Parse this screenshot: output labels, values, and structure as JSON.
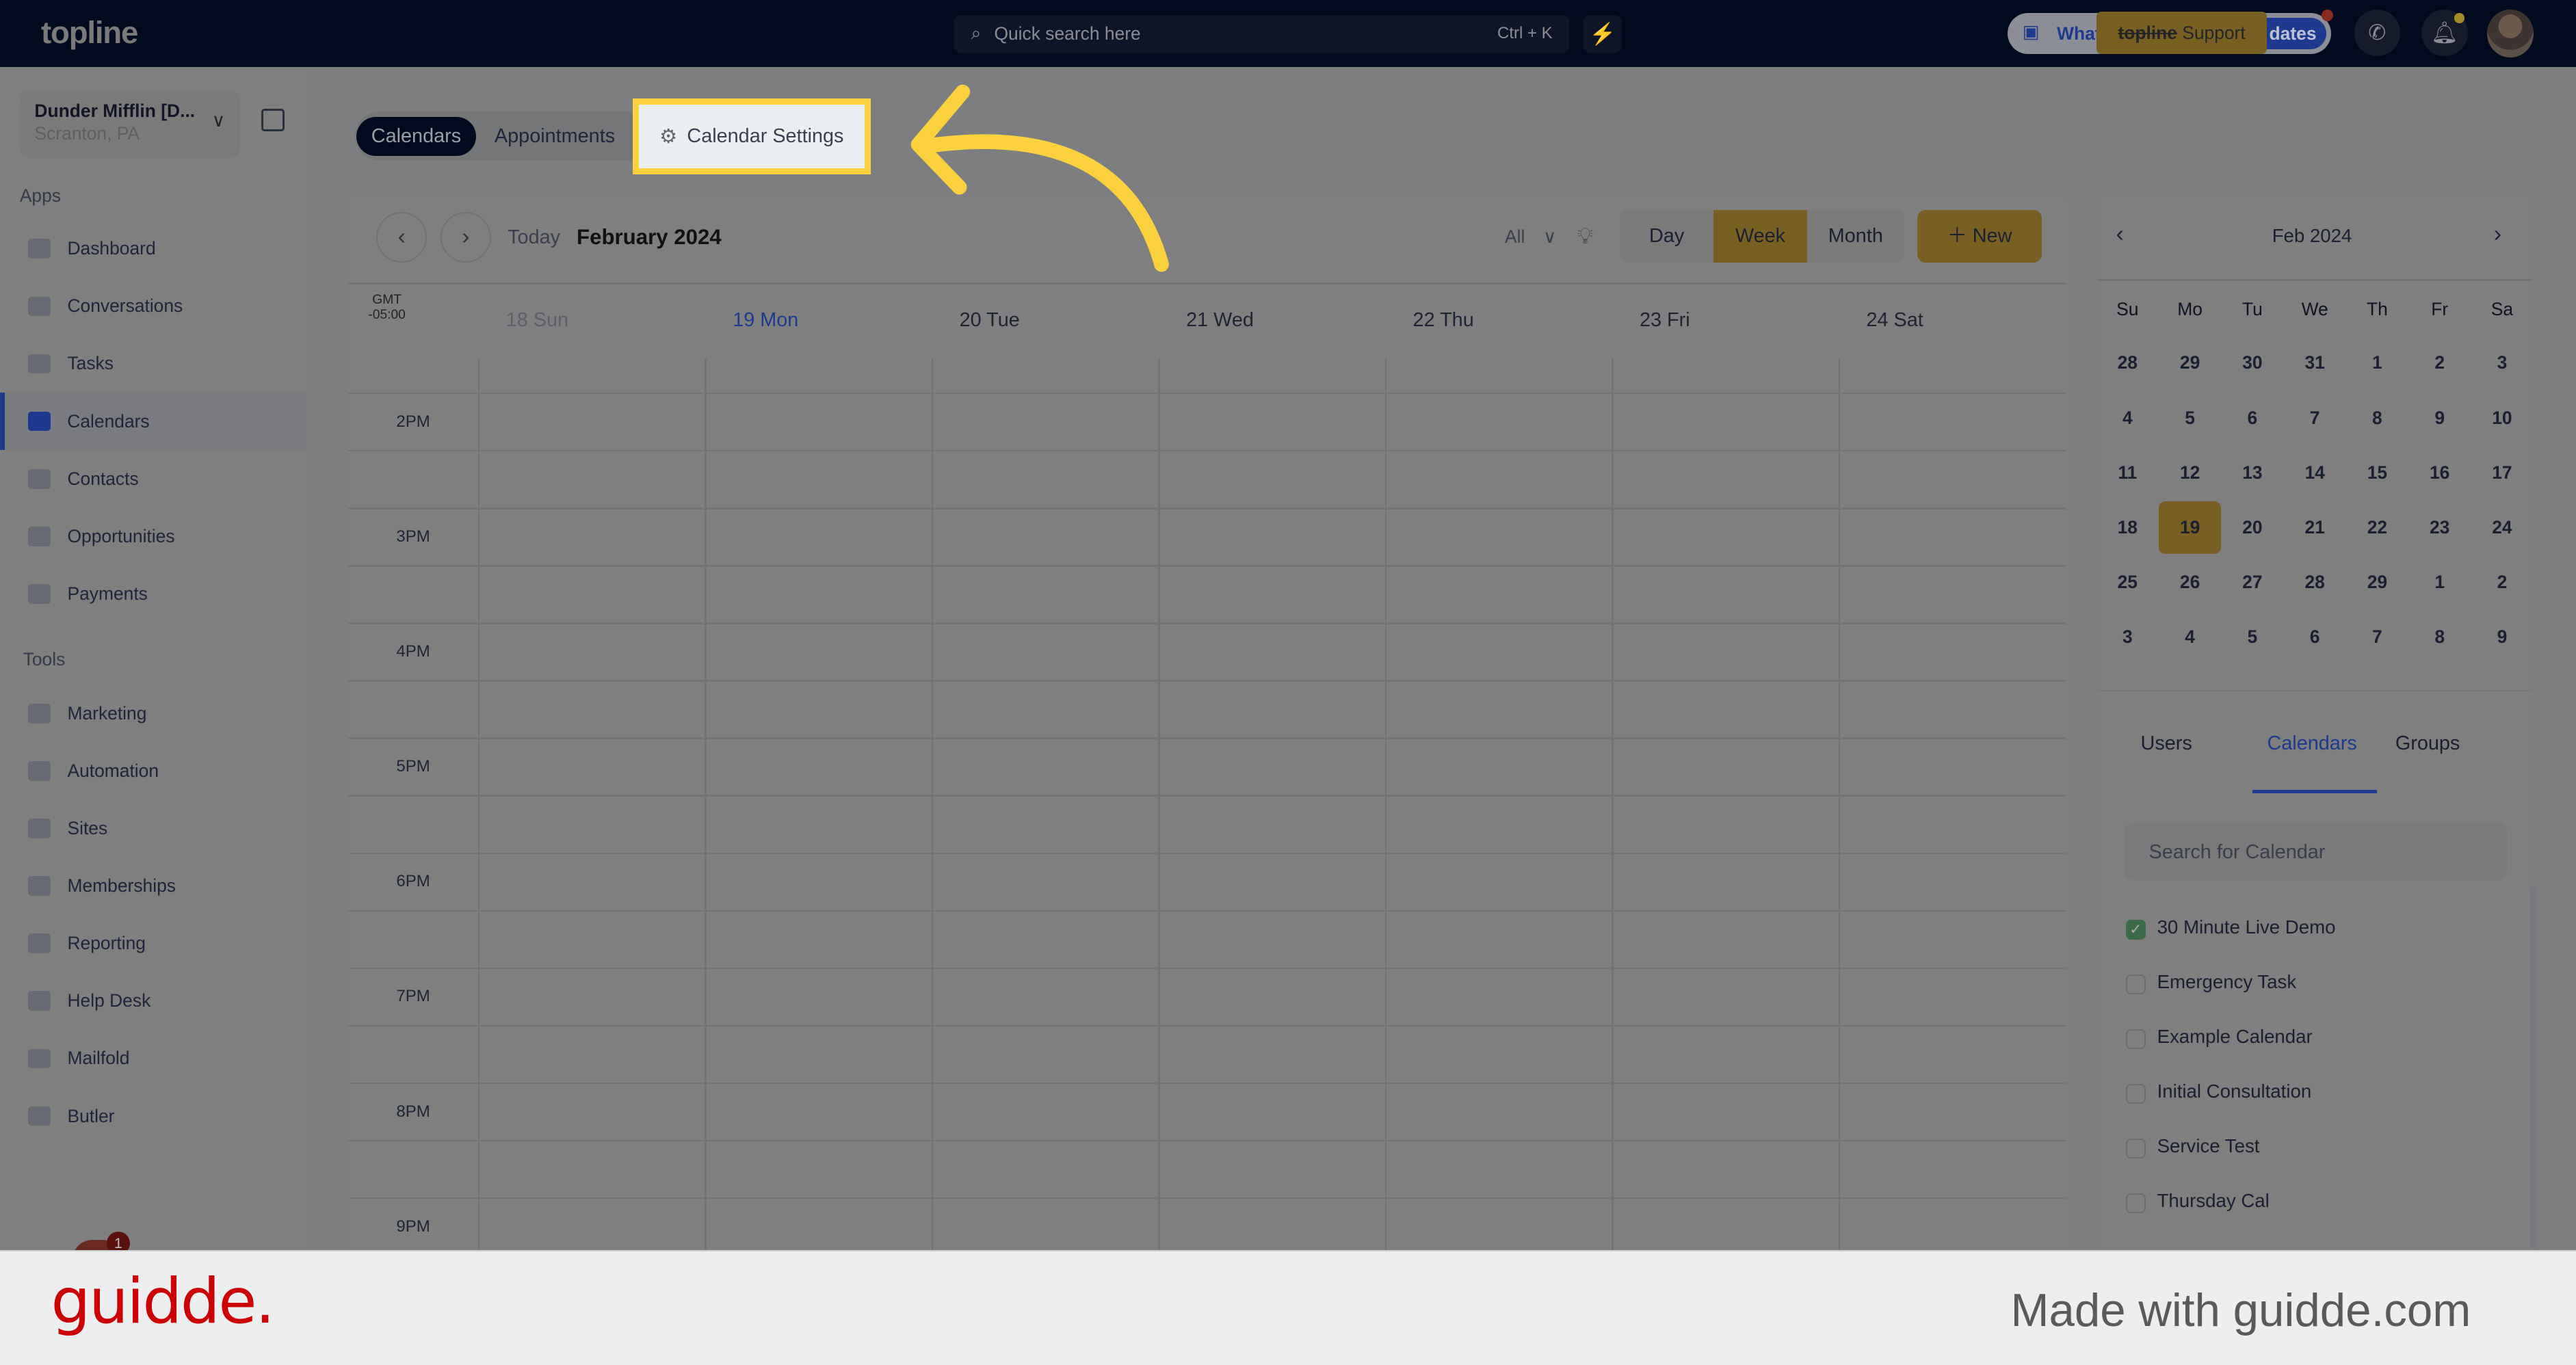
{
  "topbar": {
    "logo": "topline",
    "search_placeholder": "Quick search here",
    "search_shortcut": "Ctrl + K",
    "whats_new_left": "What",
    "whats_new_right": "dates",
    "support_brand": "topline",
    "support_label": "Support"
  },
  "account": {
    "name": "Dunder Mifflin [D...",
    "location": "Scranton, PA"
  },
  "sidebar": {
    "apps_title": "Apps",
    "apps": [
      {
        "label": "Dashboard"
      },
      {
        "label": "Conversations"
      },
      {
        "label": "Tasks"
      },
      {
        "label": "Calendars",
        "active": true
      },
      {
        "label": "Contacts"
      },
      {
        "label": "Opportunities"
      },
      {
        "label": "Payments"
      }
    ],
    "tools_title": "Tools",
    "tools": [
      {
        "label": "Marketing"
      },
      {
        "label": "Automation"
      },
      {
        "label": "Sites"
      },
      {
        "label": "Memberships"
      },
      {
        "label": "Reporting"
      },
      {
        "label": "Help Desk"
      },
      {
        "label": "Mailfold"
      },
      {
        "label": "Butler"
      }
    ],
    "chat_badge": "1"
  },
  "tabs": {
    "calendars": "Calendars",
    "appointments": "Appointments",
    "settings": "Calendar Settings"
  },
  "toolbar": {
    "today": "Today",
    "period": "February 2024",
    "filter": "All",
    "day": "Day",
    "week": "Week",
    "month": "Month",
    "new": "New",
    "active_view": "Week"
  },
  "week": {
    "timezone_top": "GMT",
    "timezone_bottom": "-05:00",
    "days": [
      {
        "label": "18 Sun"
      },
      {
        "label": "19 Mon",
        "today": true
      },
      {
        "label": "20 Tue"
      },
      {
        "label": "21 Wed"
      },
      {
        "label": "22 Thu"
      },
      {
        "label": "23 Fri"
      },
      {
        "label": "24 Sat"
      }
    ],
    "times": [
      "2PM",
      "3PM",
      "4PM",
      "5PM",
      "6PM",
      "7PM",
      "8PM",
      "9PM"
    ]
  },
  "mini_calendar": {
    "title": "Feb 2024",
    "weekdays": [
      "Su",
      "Mo",
      "Tu",
      "We",
      "Th",
      "Fr",
      "Sa"
    ],
    "weeks": [
      [
        "28",
        "29",
        "30",
        "31",
        "1",
        "2",
        "3"
      ],
      [
        "4",
        "5",
        "6",
        "7",
        "8",
        "9",
        "10"
      ],
      [
        "11",
        "12",
        "13",
        "14",
        "15",
        "16",
        "17"
      ],
      [
        "18",
        "19",
        "20",
        "21",
        "22",
        "23",
        "24"
      ],
      [
        "25",
        "26",
        "27",
        "28",
        "29",
        "1",
        "2"
      ],
      [
        "3",
        "4",
        "5",
        "6",
        "7",
        "8",
        "9"
      ]
    ],
    "selected": "19"
  },
  "filter_tabs": {
    "users": "Users",
    "calendars": "Calendars",
    "groups": "Groups",
    "active": "Calendars"
  },
  "calendar_search_placeholder": "Search for Calendar",
  "calendar_list": [
    {
      "label": "30 Minute Live Demo",
      "checked": true
    },
    {
      "label": "Emergency Task",
      "checked": false
    },
    {
      "label": "Example Calendar",
      "checked": false
    },
    {
      "label": "Initial Consultation",
      "checked": false
    },
    {
      "label": "Service Test",
      "checked": false
    },
    {
      "label": "Thursday Cal",
      "checked": false
    }
  ],
  "colors": {
    "highlight": "#fdd13e",
    "accent": "#7a5f23",
    "topbar": "#020a1f",
    "brand_red": "#cc0000"
  },
  "footer": {
    "logo": "guidde.",
    "credit": "Made with guidde.com"
  }
}
